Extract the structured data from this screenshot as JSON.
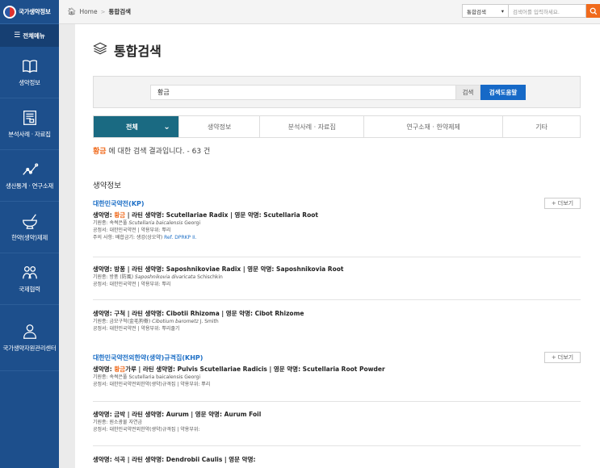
{
  "sidebar": {
    "logo": "국가생약정보",
    "allmenu": "전체메뉴",
    "items": [
      {
        "label": "생약정보",
        "icon": "book-icon"
      },
      {
        "label": "분석사례 · 자료집",
        "icon": "document-icon"
      },
      {
        "label": "생산통계 · 연구소재",
        "icon": "chart-line-icon"
      },
      {
        "label": "한약(생약)제제",
        "icon": "mortar-icon"
      },
      {
        "label": "국제협력",
        "icon": "people-icon"
      },
      {
        "label": "국가생약자원관리센터",
        "icon": "person-icon"
      }
    ]
  },
  "topbar": {
    "home": "Home",
    "current": "통합검색",
    "select_value": "통합검색",
    "search_placeholder": "검색어를 입력하세요."
  },
  "main": {
    "title": "통합검색",
    "search": {
      "value": "황금",
      "search_label": "검색",
      "help_label": "검색도움말"
    },
    "tabs": [
      "전체",
      "생약정보",
      "분석사례 · 자료집",
      "연구소재 · 한약제제",
      "기타"
    ],
    "result": {
      "keyword": "황금",
      "text": " 에 대한 검색 결과입니다. - 63 건"
    },
    "section": "생약정보",
    "more_label": "더보기",
    "group1": {
      "title": "대한민국약전(KP)",
      "entries": [
        {
          "h_pre": "생약명: ",
          "h_hl": "황금",
          "h_post": " | 라틴 생약명: Scutellariae Radix | 영문 약명: Scutellaria Root",
          "origin_pre": "기원종: 속썩은풀 ",
          "origin_sci": "Scutellaria baicalensis",
          "origin_post": " Georgi",
          "line2": "공정서: 대한민국약전 | 약용부위: 뿌리",
          "line3_pre": "주의 사항: 배합금기: 생강(상오약) ",
          "line3_ref": "Ref. DPRKP II."
        },
        {
          "h": "생약명: 방풍 | 라틴 생약명: Saposhnikoviae Radix | 영문 약명: Saposhnikovia Root",
          "origin_pre": "기원종: 방풍 (防風) ",
          "origin_sci": "Saposhnikovia divaricata",
          "origin_post": " Schischkin",
          "line2": "공정서: 대한민국약전 | 약용부위: 뿌리"
        },
        {
          "h": "생약명: 구척 | 라틴 생약명: Cibotii Rhizoma | 영문 약명: Cibot Rhizome",
          "origin_pre": "기원종: 금모구척(金毛狗脊) ",
          "origin_sci": "Cibotium barometz",
          "origin_post": " J. Smith",
          "line2": "공정서: 대한민국약전 | 약용부위: 뿌리줄기"
        }
      ]
    },
    "group2": {
      "title": "대한민국약전외한약(생약)규격집(KHP)",
      "entries": [
        {
          "h_pre": "생약명: ",
          "h_hl": "황금",
          "h_post": "가루 | 라틴 생약명: Pulvis Scutellariae Radicis | 영문 약명: Scutellaria Root Powder",
          "origin": "기원종: 속썩은풀 Scutellaria baicalensis Georgi",
          "line2": "공정서: 대한민국약전외한약(생약)규격집 | 약용부위: 뿌리"
        },
        {
          "h": "생약명: 금박 | 라틴 생약명: Aurum | 영문 약명: Aurum Foil",
          "origin": "기원종: 원소광물 자연금",
          "line2": "공정서: 대한민국약전외한약(생약)규격집 | 약용부위:"
        },
        {
          "h": "생약명: 석곡 | 라틴 생약명: Dendrobii Caulis | 영문 약명:"
        }
      ]
    }
  }
}
